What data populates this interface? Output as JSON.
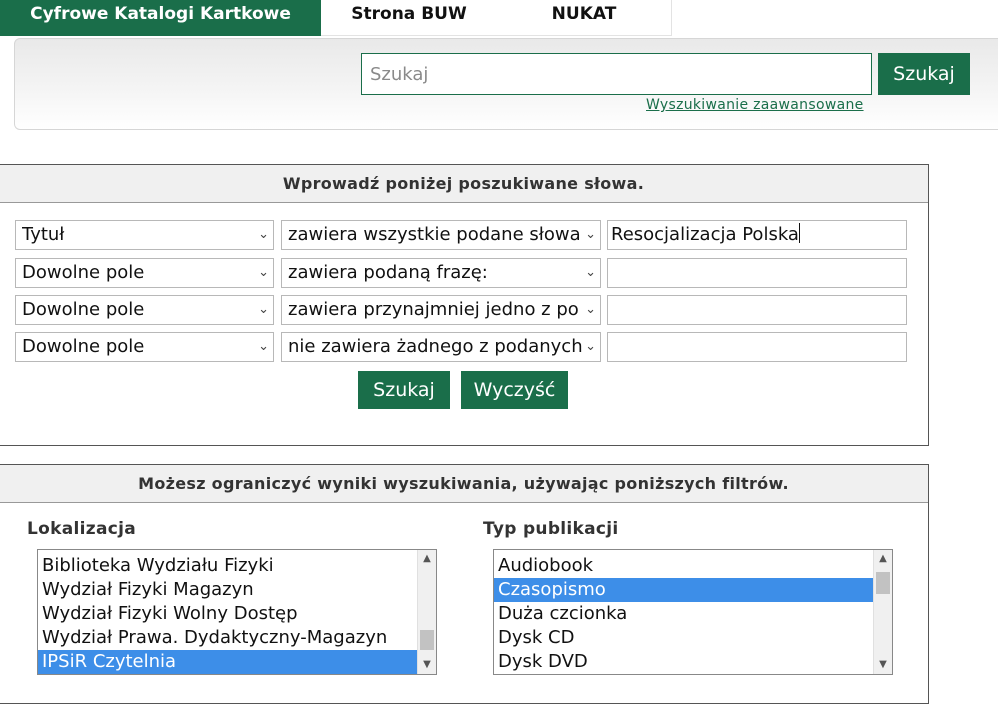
{
  "tabs": [
    {
      "label": "Cyfrowe Katalogi Kartkowe",
      "active": true
    },
    {
      "label": "Strona BUW",
      "active": false
    },
    {
      "label": "NUKAT",
      "active": false
    }
  ],
  "search": {
    "placeholder": "Szukaj",
    "value": "",
    "button_label": "Szukaj",
    "advanced_link": "Wyszukiwanie zaawansowane"
  },
  "query": {
    "header": "Wprowadź poniżej poszukiwane słowa.",
    "rows": [
      {
        "field": "Tytuł",
        "operator": "zawiera wszystkie podane słowa",
        "value": "Resocjalizacja Polska"
      },
      {
        "field": "Dowolne pole",
        "operator": "zawiera podaną frazę:",
        "value": ""
      },
      {
        "field": "Dowolne pole",
        "operator": "zawiera przynajmniej jedno z po",
        "value": ""
      },
      {
        "field": "Dowolne pole",
        "operator": "nie zawiera żadnego z podanych",
        "value": ""
      }
    ],
    "search_label": "Szukaj",
    "clear_label": "Wyczyść"
  },
  "filters": {
    "header": "Możesz ograniczyć wyniki wyszukiwania, używając poniższych filtrów.",
    "location": {
      "label": "Lokalizacja",
      "options": [
        "Biblioteka Wydziału Fizyki",
        "Wydział Fizyki Magazyn",
        "Wydział Fizyki Wolny Dostęp",
        "Wydział Prawa. Dydaktyczny-Magazyn",
        "IPSiR Czytelnia"
      ],
      "selected": "IPSiR Czytelnia"
    },
    "publication_type": {
      "label": "Typ publikacji",
      "options": [
        "Audiobook",
        "Czasopismo",
        "Duża czcionka",
        "Dysk CD",
        "Dysk DVD"
      ],
      "selected": "Czasopismo"
    }
  },
  "colors": {
    "accent": "#1a6e4a",
    "selection": "#3d8ee8"
  }
}
